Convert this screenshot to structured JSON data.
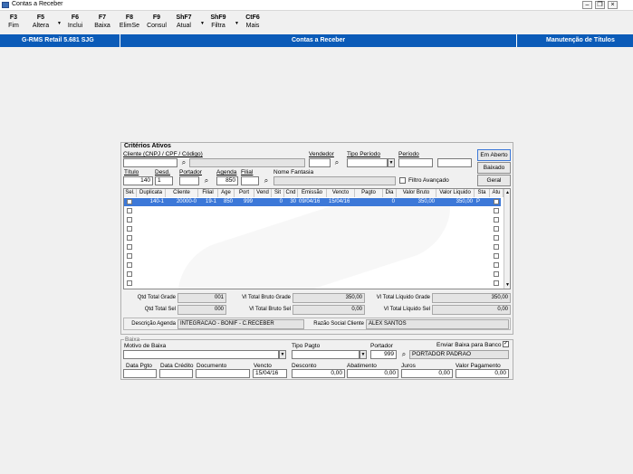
{
  "window": {
    "title": "Contas a Receber"
  },
  "toolbar": [
    {
      "key": "F3",
      "label": "Fim",
      "arrow": false
    },
    {
      "key": "F5",
      "label": "Altera",
      "arrow": true
    },
    {
      "key": "F6",
      "label": "Inclui",
      "arrow": false
    },
    {
      "key": "F7",
      "label": "Baixa",
      "arrow": false
    },
    {
      "key": "F8",
      "label": "ElimSe",
      "arrow": false
    },
    {
      "key": "F9",
      "label": "Consul",
      "arrow": false
    },
    {
      "key": "ShF7",
      "label": "Atual",
      "arrow": true
    },
    {
      "key": "ShF9",
      "label": "Filtra",
      "arrow": true
    },
    {
      "key": "CtF6",
      "label": "Mais",
      "arrow": false
    }
  ],
  "header": {
    "app": "G-RMS Retail 5.681 SJG",
    "module": "Contas a Receber",
    "screen": "Manutenção de Títulos"
  },
  "criteria": {
    "group_title": "Critérios Ativos",
    "cliente_label": "Cliente (CNPJ / CPF / Código)",
    "vendedor_label": "Vendedor",
    "tipo_periodo_label": "Tipo Período",
    "periodo_label": "Período",
    "titulo_label": "Título",
    "titulo_value": "140",
    "desd_label": "Desd.",
    "desd_value": "1",
    "portador_label": "Portador",
    "agenda_label": "Agenda",
    "agenda_value": "850",
    "filial_label": "Filial",
    "nome_fantasia_label": "Nome Fantasia",
    "filtro_avancado_label": "Filtro Avançado",
    "buttons": [
      "Em Aberto",
      "Baixado",
      "Geral"
    ]
  },
  "grid": {
    "columns": [
      "Sel.",
      "Duplicata",
      "Cliente",
      "Filial",
      "Age",
      "Port",
      "Vend",
      "Sit",
      "Cnd",
      "Emissão",
      "Vencto",
      "Pagto",
      "Dia",
      "Valor Bruto",
      "Valor Liquido",
      "Sta",
      "Atu"
    ],
    "row": [
      "",
      "140-1",
      "20000-0",
      "19-1",
      "850",
      "999",
      "",
      "0",
      "30",
      "09/04/16",
      "15/04/16",
      "",
      "0",
      "350,00",
      "350,00",
      "P",
      ""
    ],
    "empty_rows": 9
  },
  "totals": {
    "qtd_total_grade_label": "Qtd Total Grade",
    "qtd_total_grade": "001",
    "vl_bruto_grade_label": "Vl Total Bruto Grade",
    "vl_bruto_grade": "350,00",
    "vl_liquido_grade_label": "Vl Total Líquido Grade",
    "vl_liquido_grade": "350,00",
    "qtd_total_sel_label": "Qtd Total Sel",
    "qtd_total_sel": "000",
    "vl_bruto_sel_label": "Vl Total Bruto Sel",
    "vl_bruto_sel": "0,00",
    "vl_liquido_sel_label": "Vl Total Líquido Sel",
    "vl_liquido_sel": "0,00",
    "descricao_agenda_label": "Descrição Agenda",
    "descricao_agenda": "INTEGRACAO - BONIF - C.RECEBER",
    "razao_social_label": "Razão Social Cliente",
    "razao_social": "ALEX SANTOS"
  },
  "baixa": {
    "group_title": "Baixa",
    "motivo_label": "Motivo de Baixa",
    "tipo_pagto_label": "Tipo Pagto",
    "portador_label": "Portador",
    "portador_value": "999",
    "portador_nome": "PORTADOR PADRAO",
    "enviar_label": "Enviar Baixa para Banco",
    "data_pgto_label": "Data Pgto",
    "data_credito_label": "Data Crédito",
    "documento_label": "Documento",
    "vencto_label": "Vencto",
    "vencto_value": "15/04/16",
    "desconto_label": "Desconto",
    "desconto_value": "0,00",
    "abatimento_label": "Abatimento",
    "abatimento_value": "0,00",
    "juros_label": "Juros",
    "juros_value": "0,00",
    "valor_pagamento_label": "Valor Pagamento",
    "valor_pagamento_value": "0,00"
  }
}
